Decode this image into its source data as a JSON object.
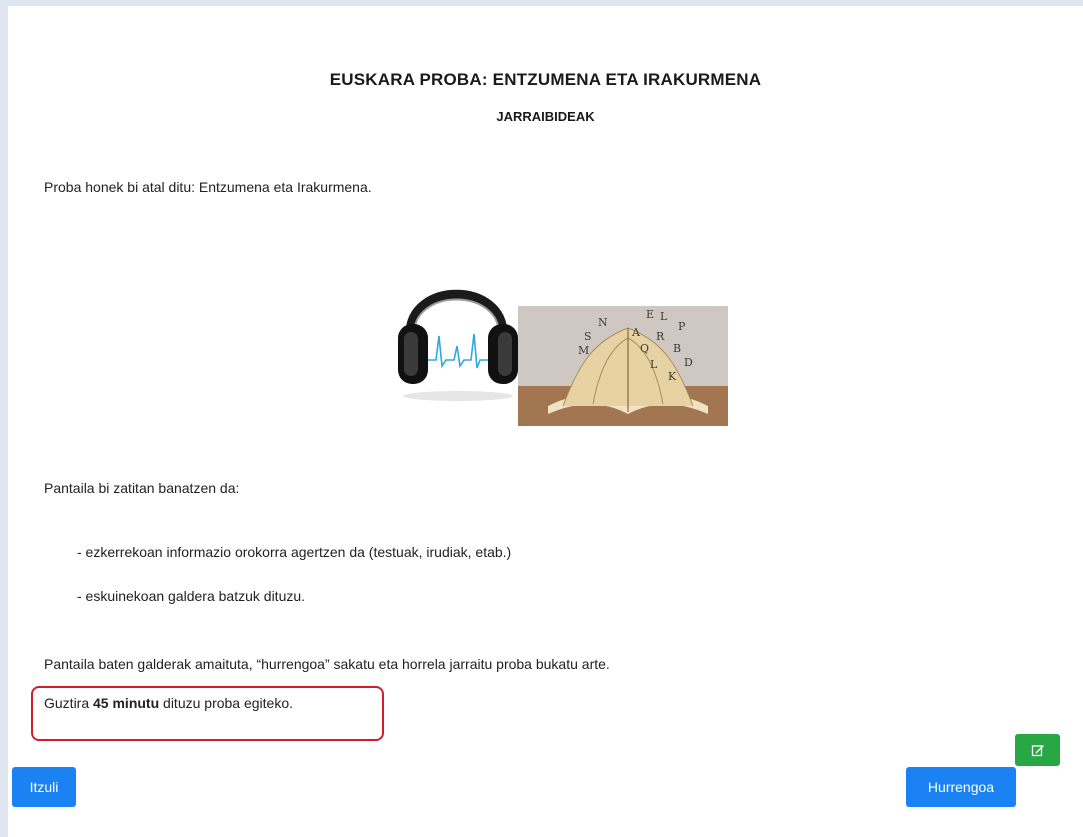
{
  "header": {
    "title": "EUSKARA PROBA: ENTZUMENA ETA IRAKURMENA",
    "subtitle": "JARRAIBIDEAK"
  },
  "content": {
    "intro": "Proba honek bi atal ditu: Entzumena eta Irakurmena.",
    "screen_split": "Pantaila bi zatitan banatzen da:",
    "list": [
      "- ezkerrekoan informazio orokorra agertzen da (testuak, irudiak, etab.)",
      "- eskuinekoan galdera batzuk dituzu."
    ],
    "next_instruction": "Pantaila baten galderak amaituta, “hurrengoa” sakatu eta horrela jarraitu proba bukatu arte.",
    "time_prefix": "Guztira ",
    "time_bold": "45 minutu",
    "time_suffix": " dituzu proba egiteko."
  },
  "illustration": {
    "icons": [
      "headphones-icon",
      "open-book-icon"
    ],
    "book_letters": [
      "N",
      "E",
      "L",
      "P",
      "S",
      "A",
      "R",
      "M",
      "Q",
      "B",
      "D",
      "L",
      "K"
    ]
  },
  "buttons": {
    "back_label": "Itzuli",
    "next_label": "Hurrengoa",
    "edit_icon": "edit-icon"
  },
  "colors": {
    "primary": "#1a82f2",
    "success": "#28a745",
    "highlight": "#d41c2a"
  }
}
